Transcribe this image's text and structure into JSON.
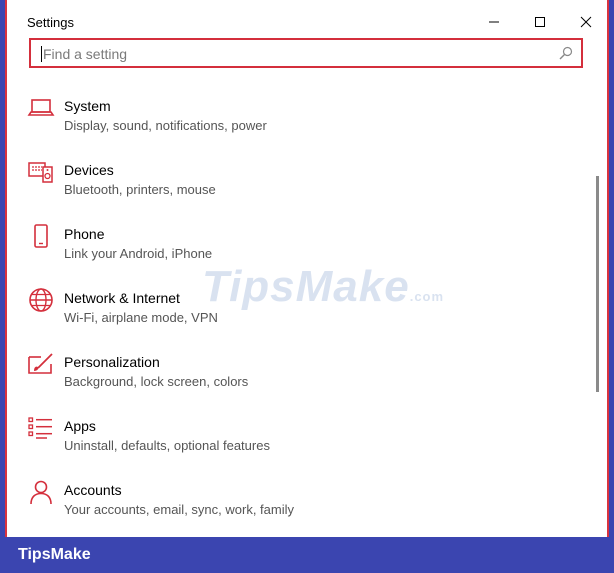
{
  "window": {
    "title": "Settings"
  },
  "search": {
    "placeholder": "Find a setting",
    "value": ""
  },
  "items": [
    {
      "name": "System",
      "desc": "Display, sound, notifications, power",
      "icon": "laptop-icon"
    },
    {
      "name": "Devices",
      "desc": "Bluetooth, printers, mouse",
      "icon": "devices-icon"
    },
    {
      "name": "Phone",
      "desc": "Link your Android, iPhone",
      "icon": "phone-icon"
    },
    {
      "name": "Network & Internet",
      "desc": "Wi-Fi, airplane mode, VPN",
      "icon": "globe-icon"
    },
    {
      "name": "Personalization",
      "desc": "Background, lock screen, colors",
      "icon": "paintbrush-icon"
    },
    {
      "name": "Apps",
      "desc": "Uninstall, defaults, optional features",
      "icon": "apps-list-icon"
    },
    {
      "name": "Accounts",
      "desc": "Your accounts, email, sync, work, family",
      "icon": "person-icon"
    }
  ],
  "watermark": {
    "main": "TipsMake",
    "suffix": ".com"
  },
  "footer": {
    "brand": "TipsMake"
  },
  "colors": {
    "accent": "#d42f3c",
    "frame": "#3b45b0"
  }
}
